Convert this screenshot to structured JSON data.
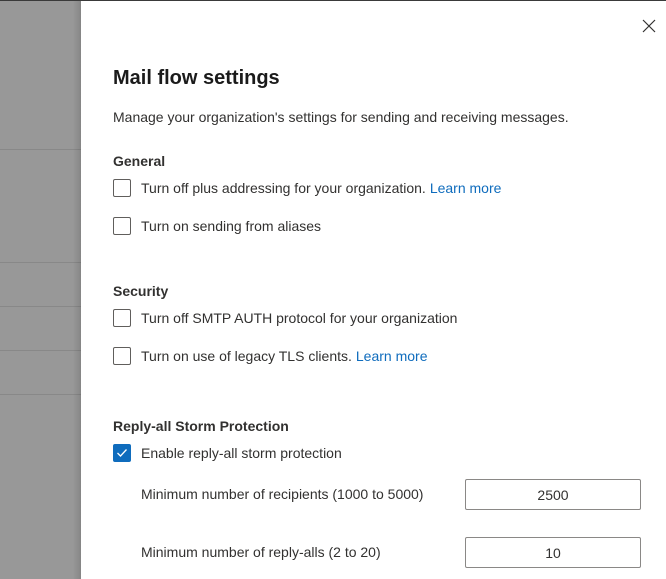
{
  "panel": {
    "title": "Mail flow settings",
    "description": "Manage your organization's settings for sending and receiving messages.",
    "close_icon": "close-icon"
  },
  "sections": {
    "general": {
      "heading": "General",
      "options": [
        {
          "label": "Turn off plus addressing for your organization.",
          "link": "Learn more",
          "checked": false
        },
        {
          "label": "Turn on sending from aliases",
          "checked": false
        }
      ]
    },
    "security": {
      "heading": "Security",
      "options": [
        {
          "label": "Turn off SMTP AUTH protocol for your organization",
          "checked": false
        },
        {
          "label": "Turn on use of legacy TLS clients.",
          "link": "Learn more",
          "checked": true
        }
      ]
    },
    "reply_all": {
      "heading": "Reply-all Storm Protection",
      "enable": {
        "label": "Enable reply-all storm protection",
        "checked": true
      },
      "fields": [
        {
          "label": "Minimum number of recipients (1000 to 5000)",
          "value": "2500"
        },
        {
          "label": "Minimum number of reply-alls (2 to 20)",
          "value": "10"
        }
      ]
    }
  },
  "colors": {
    "accent": "#0f6cbd",
    "overlay": "#979797"
  }
}
